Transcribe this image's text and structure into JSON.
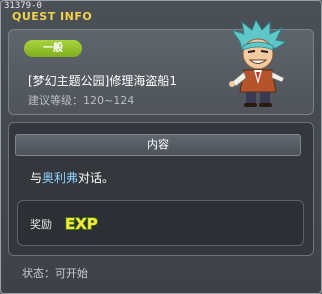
{
  "window": {
    "quest_id": "31379-0",
    "title": "QUEST INFO"
  },
  "quest": {
    "category": "一般",
    "title": "[梦幻主题公园]修理海盗船1",
    "level_label": "建议等级：",
    "level_range": "120~124"
  },
  "content": {
    "header": "内容",
    "objective_prefix": "与",
    "npc_name": "奥利弗",
    "objective_suffix": "对话。"
  },
  "reward": {
    "label": "奖励",
    "icon": "exp-icon",
    "icon_text": "EXP"
  },
  "status": {
    "text": "状态：可开始"
  },
  "colors": {
    "title_gold": "#f2d24a",
    "badge_green": "#8fbf26",
    "npc_name_blue": "#8ed2ff",
    "exp_yellow": "#f7e93a",
    "exp_green": "#7ec228"
  }
}
